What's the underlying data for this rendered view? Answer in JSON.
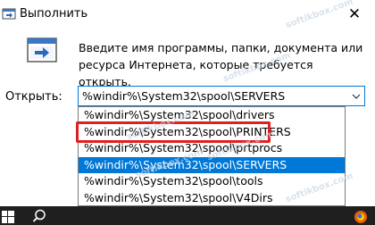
{
  "window": {
    "title": "Выполнить",
    "close_glyph": "✕"
  },
  "description": "Введите имя программы, папки, документа или ресурса Интернета, которые требуется открыть.",
  "open": {
    "label": "Открыть:",
    "value": "%windir%\\System32\\spool\\SERVERS"
  },
  "dropdown": {
    "items": [
      "%windir%\\System32\\spool\\drivers",
      "%windir%\\System32\\spool\\PRINTERS",
      "%windir%\\System32\\spool\\prtprocs",
      "%windir%\\System32\\spool\\SERVERS",
      "%windir%\\System32\\spool\\tools",
      "%windir%\\System32\\spool\\V4Dirs"
    ],
    "selected_index": 3,
    "highlighted_index": 1
  },
  "watermarks": [
    "softikbox.com",
    "softikbox.com",
    "softikbox.com",
    "softikbox.com",
    "softikbox.com",
    "softikbox.com"
  ],
  "colors": {
    "accent": "#0078d7",
    "highlight": "#e02020",
    "taskbar": "#1f1f1f"
  },
  "icons": [
    "run-app-icon",
    "close-icon",
    "run-dialog-icon",
    "chevron-down-icon",
    "windows-start-icon",
    "search-icon",
    "firefox-icon"
  ]
}
